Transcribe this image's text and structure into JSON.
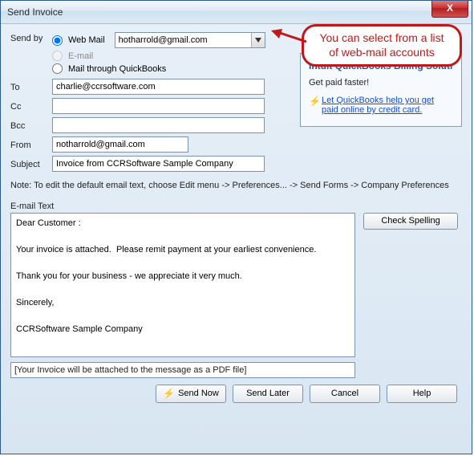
{
  "window": {
    "title": "Send Invoice"
  },
  "sendby": {
    "label": "Send by",
    "webmail_label": "Web Mail",
    "email_label": "E-mail",
    "quickbooks_label": "Mail through QuickBooks",
    "selected_account": "hotharrold@gmail.com"
  },
  "fields": {
    "to_label": "To",
    "to_value": "charlie@ccrsoftware.com",
    "cc_label": "Cc",
    "cc_value": "",
    "bcc_label": "Bcc",
    "bcc_value": "",
    "from_label": "From",
    "from_value": "notharrold@gmail.com",
    "subject_label": "Subject",
    "subject_value": "Invoice from CCRSoftware Sample Company"
  },
  "side_panel": {
    "header": "Intuit QuickBooks Billing Solution",
    "subheader": "Get paid faster!",
    "link_line1": "Let QuickBooks help you get",
    "link_line2": "paid online by credit card."
  },
  "callout": {
    "text": "You can select from a list of web-mail accounts"
  },
  "note": {
    "text": "Note: To edit the default email text, choose Edit menu -> Preferences... -> Send Forms -> Company Preferences"
  },
  "email_text": {
    "label": "E-mail Text",
    "body": "Dear Customer :\n\nYour invoice is attached.  Please remit payment at your earliest convenience.\n\nThank you for your business - we appreciate it very much.\n\nSincerely,\n\nCCRSoftware Sample Company"
  },
  "attachment_note": "[Your Invoice will be attached to the message as a PDF file]",
  "buttons": {
    "check_spelling": "Check Spelling",
    "send_now": "Send Now",
    "send_later": "Send Later",
    "cancel": "Cancel",
    "help": "Help"
  }
}
